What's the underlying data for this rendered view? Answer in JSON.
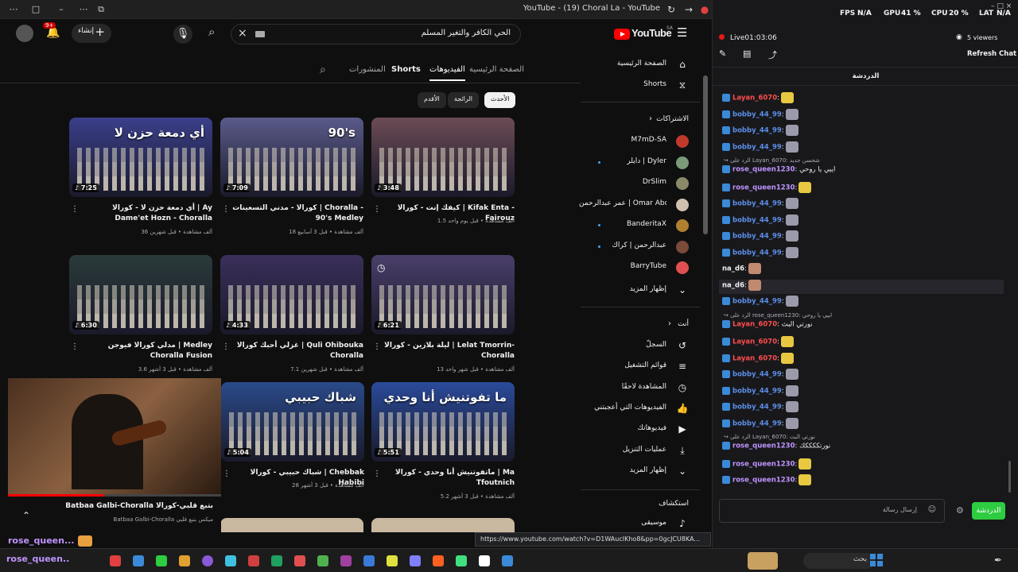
{
  "window": {
    "title": "YouTube - (19) Choral La - YouTube"
  },
  "header": {
    "search_query": "الحي الكافر والتغير المسلم",
    "create_label": "إنشاء",
    "notif_count": "9+",
    "logo_text": "YouTube",
    "country_code": "SA"
  },
  "channel_tabs": [
    {
      "label": "الصفحة الرئيسية",
      "active": false
    },
    {
      "label": "الفيديوهات",
      "active": true
    },
    {
      "label": "Shorts",
      "active": false
    },
    {
      "label": "المنشورات",
      "active": false
    }
  ],
  "chips": [
    {
      "label": "الأحدث",
      "selected": true
    },
    {
      "label": "الرائجة",
      "selected": false
    },
    {
      "label": "الأقدم",
      "selected": false
    }
  ],
  "videos": [
    {
      "title": "كيفك إنت - كورالا | Kifak Enta - Fairouz",
      "meta": "1.5 ألف مشاهدة • قبل يوم واحد",
      "duration": "3:48",
      "color": "#6b4b55",
      "thumb_text": ""
    },
    {
      "title": "كورالا - مدني التسعينات | Choralla - 90's Medley",
      "meta": "18 ألف مشاهدة • قبل 3 أسابيع",
      "duration": "7:09",
      "color": "#5a5a8a",
      "thumb_text": "90's"
    },
    {
      "title": "أي دمعة حزن لا - كورالا | Ay Dame'et Hozn - Choralla",
      "meta": "36 ألف مشاهدة • قبل شهرين",
      "duration": "7:25",
      "color": "#3a3f8a",
      "thumb_text": "أي دمعة حزن لا"
    },
    {
      "title": "ليلة بلازين - كورالا | Lelat Tmorrin- Choralla",
      "meta": "13 ألف مشاهدة • قبل شهر واحد",
      "duration": "6:21",
      "color": "#4a3f6a",
      "thumb_text": ""
    },
    {
      "title": "غزلي أحبك كورالا | Quli Ohibouka Choralla",
      "meta": "7.1 ألف مشاهدة • قبل شهرين",
      "duration": "4:33",
      "color": "#3a2f5a",
      "thumb_text": ""
    },
    {
      "title": "مدلي كورالا فيوجن | Medley Choralla Fusion",
      "meta": "3.6 ألف مشاهدة • قبل 3 أشهر",
      "duration": "6:30",
      "color": "#2a3a3a",
      "thumb_text": ""
    },
    {
      "title": "ماتفوتنيش أنا وحدي - كورالا | Ma Tfoutnich",
      "meta": "5.2 ألف مشاهدة • قبل 3 أشهر",
      "duration": "5:51",
      "color": "#2a4a9a",
      "thumb_text": "ما تفوتنيش أنا وحدي"
    },
    {
      "title": "شباك حبيبي - كورالا | Chebbak Habibi",
      "meta": "28 ألف مشاهدة • قبل 3 أشهر",
      "duration": "5:04",
      "color": "#2a4a8a",
      "thumb_text": "شباك حبيبي"
    }
  ],
  "miniplayer": {
    "title": "Batbaa Galbi-Choralla بتبع قلبي-كورالا",
    "subtitle": "Batbaa Galbi-Choralla ميكس بتبع قلبي"
  },
  "sidebar": {
    "home": "الصفحة الرئيسية",
    "shorts": "Shorts",
    "subscriptions_header": "الاشتراكات",
    "subscriptions": [
      {
        "label": "M7mD-SA",
        "color": "#c0392b",
        "live": false
      },
      {
        "label": "دايلر | Dyler",
        "color": "#7a9a7a",
        "live": true
      },
      {
        "label": "DrSlim",
        "color": "#8a8a6a",
        "live": false
      },
      {
        "label": "عمر عبدالرحمن | Omar Abdulrahman",
        "color": "#d0c0b0",
        "live": false
      },
      {
        "label": "BanderitaX",
        "color": "#b08030",
        "live": true
      },
      {
        "label": "عبدالرحمن | كراك",
        "color": "#7a4a3a",
        "live": true
      },
      {
        "label": "BarryTube",
        "color": "#e05050",
        "live": false
      }
    ],
    "show_more": "إظهار المزيد",
    "you_header": "أنت",
    "you_items": [
      {
        "label": "السجلّ",
        "icon": "history-icon",
        "glyph": "↺"
      },
      {
        "label": "قوائم التشغيل",
        "icon": "playlists-icon",
        "glyph": "≡"
      },
      {
        "label": "المشاهدة لاحقًا",
        "icon": "watch-later-icon",
        "glyph": "◷"
      },
      {
        "label": "الفيديوهات التي أعجبتني",
        "icon": "like-icon",
        "glyph": "👍"
      },
      {
        "label": "فيديوهاتك",
        "icon": "your-videos-icon",
        "glyph": "▶"
      },
      {
        "label": "عمليات التنزيل",
        "icon": "download-icon",
        "glyph": "⤓"
      }
    ],
    "show_more_2": "إظهار المزيد",
    "explore_header": "استكشاف",
    "music": "موسيقى"
  },
  "chat": {
    "stats": {
      "fps_label": "FPS",
      "fps": "N/A",
      "gpu_label": "GPU",
      "gpu": "41 %",
      "cpu_label": "CPU",
      "cpu": "20 %",
      "lat_label": "LAT",
      "lat": "N/A"
    },
    "live_time": "Live01:03:06",
    "viewers": "5 viewers",
    "refresh": "Refresh Chat",
    "tab_title": "الدردشة",
    "input_placeholder": "إرسال رسالة",
    "send_label": "الدردشة",
    "overlay_user": "rose_queen...",
    "overlay_user2": "rose_queen..",
    "messages": [
      {
        "user": "Layan_6070",
        "color": "#ff4d4d",
        "emote": "#e8c840",
        "reply": ""
      },
      {
        "user": "bobby_44_99",
        "color": "#5c8fe8",
        "emote": "#9a9aaa",
        "reply": ""
      },
      {
        "user": "bobby_44_99",
        "color": "#5c8fe8",
        "emote": "#9a9aaa",
        "reply": ""
      },
      {
        "user": "bobby_44_99",
        "color": "#5c8fe8",
        "emote": "#9a9aaa",
        "reply": ""
      },
      {
        "user": "rose_queen1230",
        "color": "#bf94ff",
        "emote": "",
        "text": "اييي يا روحي",
        "reply": "الرد على Layan_6070: شحسن جديد"
      },
      {
        "user": "rose_queen1230",
        "color": "#bf94ff",
        "emote": "#e8c840",
        "reply": ""
      },
      {
        "user": "bobby_44_99",
        "color": "#5c8fe8",
        "emote": "#9a9aaa",
        "reply": ""
      },
      {
        "user": "bobby_44_99",
        "color": "#5c8fe8",
        "emote": "#9a9aaa",
        "reply": ""
      },
      {
        "user": "bobby_44_99",
        "color": "#5c8fe8",
        "emote": "#9a9aaa",
        "reply": ""
      },
      {
        "user": "bobby_44_99",
        "color": "#5c8fe8",
        "emote": "#9a9aaa",
        "reply": ""
      },
      {
        "user": "na_d6",
        "color": "#efeff1",
        "emote": "#c08a70",
        "reply": ""
      },
      {
        "user": "na_d6",
        "color": "#efeff1",
        "emote": "#c08a70",
        "reply": ""
      },
      {
        "user": "bobby_44_99",
        "color": "#5c8fe8",
        "emote": "#9a9aaa",
        "reply": ""
      },
      {
        "user": "Layan_6070",
        "color": "#ff4d4d",
        "emote": "",
        "text": "نورتي البث",
        "reply": "الرد على rose_queen1230: اييي يا روحي"
      },
      {
        "user": "Layan_6070",
        "color": "#ff4d4d",
        "emote": "#e8c840",
        "reply": ""
      },
      {
        "user": "Layan_6070",
        "color": "#ff4d4d",
        "emote": "#e8c840",
        "reply": ""
      },
      {
        "user": "bobby_44_99",
        "color": "#5c8fe8",
        "emote": "#9a9aaa",
        "reply": ""
      },
      {
        "user": "bobby_44_99",
        "color": "#5c8fe8",
        "emote": "#9a9aaa",
        "reply": ""
      },
      {
        "user": "bobby_44_99",
        "color": "#5c8fe8",
        "emote": "#9a9aaa",
        "reply": ""
      },
      {
        "user": "bobby_44_99",
        "color": "#5c8fe8",
        "emote": "#9a9aaa",
        "reply": ""
      },
      {
        "user": "rose_queen1230",
        "color": "#bf94ff",
        "emote": "",
        "text": "نورتككككك",
        "reply": "الرد على Layan_6070: نورتي البث"
      },
      {
        "user": "rose_queen1230",
        "color": "#bf94ff",
        "emote": "#e8c840",
        "reply": ""
      },
      {
        "user": "rose_queen1230",
        "color": "#bf94ff",
        "emote": "#e8c840",
        "reply": ""
      }
    ]
  },
  "url_hint": "https://www.youtube.com/watch?v=D1WAucIKho8&pp=0gcJCU8KA...",
  "taskbar": {
    "search_label": "بحث",
    "icons": [
      "#e04040",
      "#3a8ad8",
      "#2ecc40",
      "#e0a030",
      "#8a5ad8",
      "#40c0e0",
      "#d04040",
      "#20a060",
      "#e05050",
      "#50b050",
      "#a040a0",
      "#3a7ad8",
      "#e0e040",
      "#8080ff",
      "#ff6020",
      "#40e080",
      "#ffffff",
      "#3a8ad8"
    ]
  }
}
